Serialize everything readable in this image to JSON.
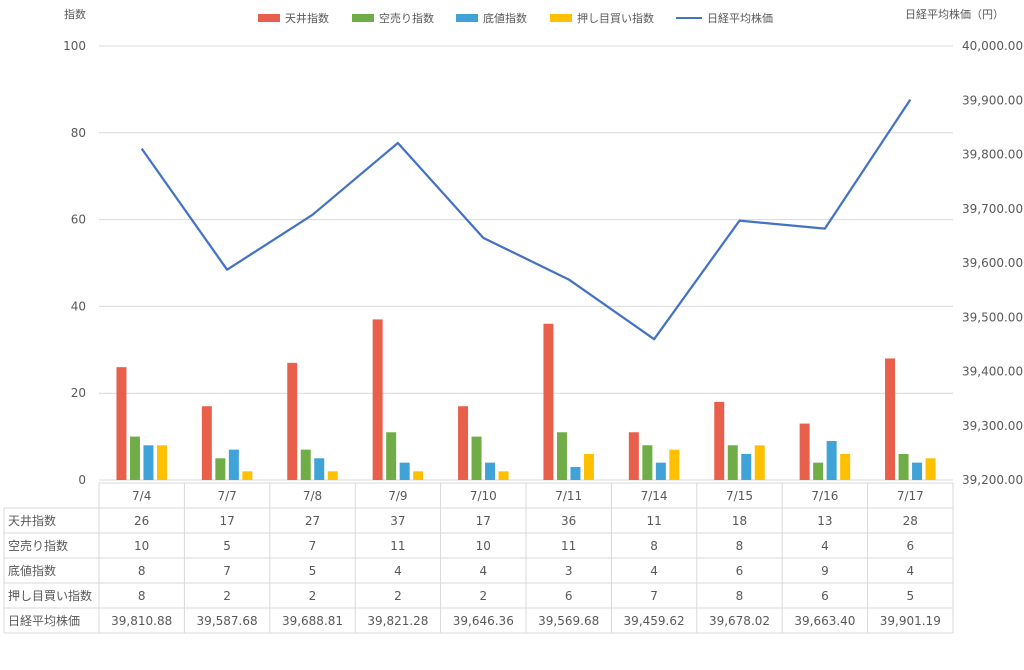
{
  "chart_data": {
    "type": "bar+line",
    "categories": [
      "7/4",
      "7/7",
      "7/8",
      "7/9",
      "7/10",
      "7/11",
      "7/14",
      "7/15",
      "7/16",
      "7/17"
    ],
    "series": [
      {
        "name": "天井指数",
        "type": "bar",
        "axis": "left",
        "color": "#E8604C",
        "values": [
          26,
          17,
          27,
          37,
          17,
          36,
          11,
          18,
          13,
          28
        ]
      },
      {
        "name": "空売り指数",
        "type": "bar",
        "axis": "left",
        "color": "#70AD47",
        "values": [
          10,
          5,
          7,
          11,
          10,
          11,
          8,
          8,
          4,
          6
        ]
      },
      {
        "name": "底値指数",
        "type": "bar",
        "axis": "left",
        "color": "#3FA3D8",
        "values": [
          8,
          7,
          5,
          4,
          4,
          3,
          4,
          6,
          9,
          4
        ]
      },
      {
        "name": "押し目買い指数",
        "type": "bar",
        "axis": "left",
        "color": "#FFC000",
        "values": [
          8,
          2,
          2,
          2,
          2,
          6,
          7,
          8,
          6,
          5
        ]
      },
      {
        "name": "日経平均株価",
        "type": "line",
        "axis": "right",
        "color": "#4472C4",
        "values": [
          39810.88,
          39587.68,
          39688.81,
          39821.28,
          39646.36,
          39569.68,
          39459.62,
          39678.02,
          39663.4,
          39901.19
        ]
      }
    ],
    "table_values": {
      "天井指数": [
        "26",
        "17",
        "27",
        "37",
        "17",
        "36",
        "11",
        "18",
        "13",
        "28"
      ],
      "空売り指数": [
        "10",
        "5",
        "7",
        "11",
        "10",
        "11",
        "8",
        "8",
        "4",
        "6"
      ],
      "底値指数": [
        "8",
        "7",
        "5",
        "4",
        "4",
        "3",
        "4",
        "6",
        "9",
        "4"
      ],
      "押し目買い指数": [
        "8",
        "2",
        "2",
        "2",
        "2",
        "6",
        "7",
        "8",
        "6",
        "5"
      ],
      "日経平均株価": [
        "39,810.88",
        "39,587.68",
        "39,688.81",
        "39,821.28",
        "39,646.36",
        "39,569.68",
        "39,459.62",
        "39,678.02",
        "39,663.40",
        "39,901.19"
      ]
    },
    "ylabel": "指数",
    "y2label": "日経平均株価（円）",
    "ylim": [
      0,
      100
    ],
    "yticks": [
      "0",
      "20",
      "40",
      "60",
      "80",
      "100"
    ],
    "y2lim": [
      39200,
      40000
    ],
    "y2ticks": [
      "39,200.00",
      "39,300.00",
      "39,400.00",
      "39,500.00",
      "39,600.00",
      "39,700.00",
      "39,800.00",
      "39,900.00",
      "40,000.00"
    ],
    "grid": true,
    "legend_position": "top",
    "data_table": true
  }
}
